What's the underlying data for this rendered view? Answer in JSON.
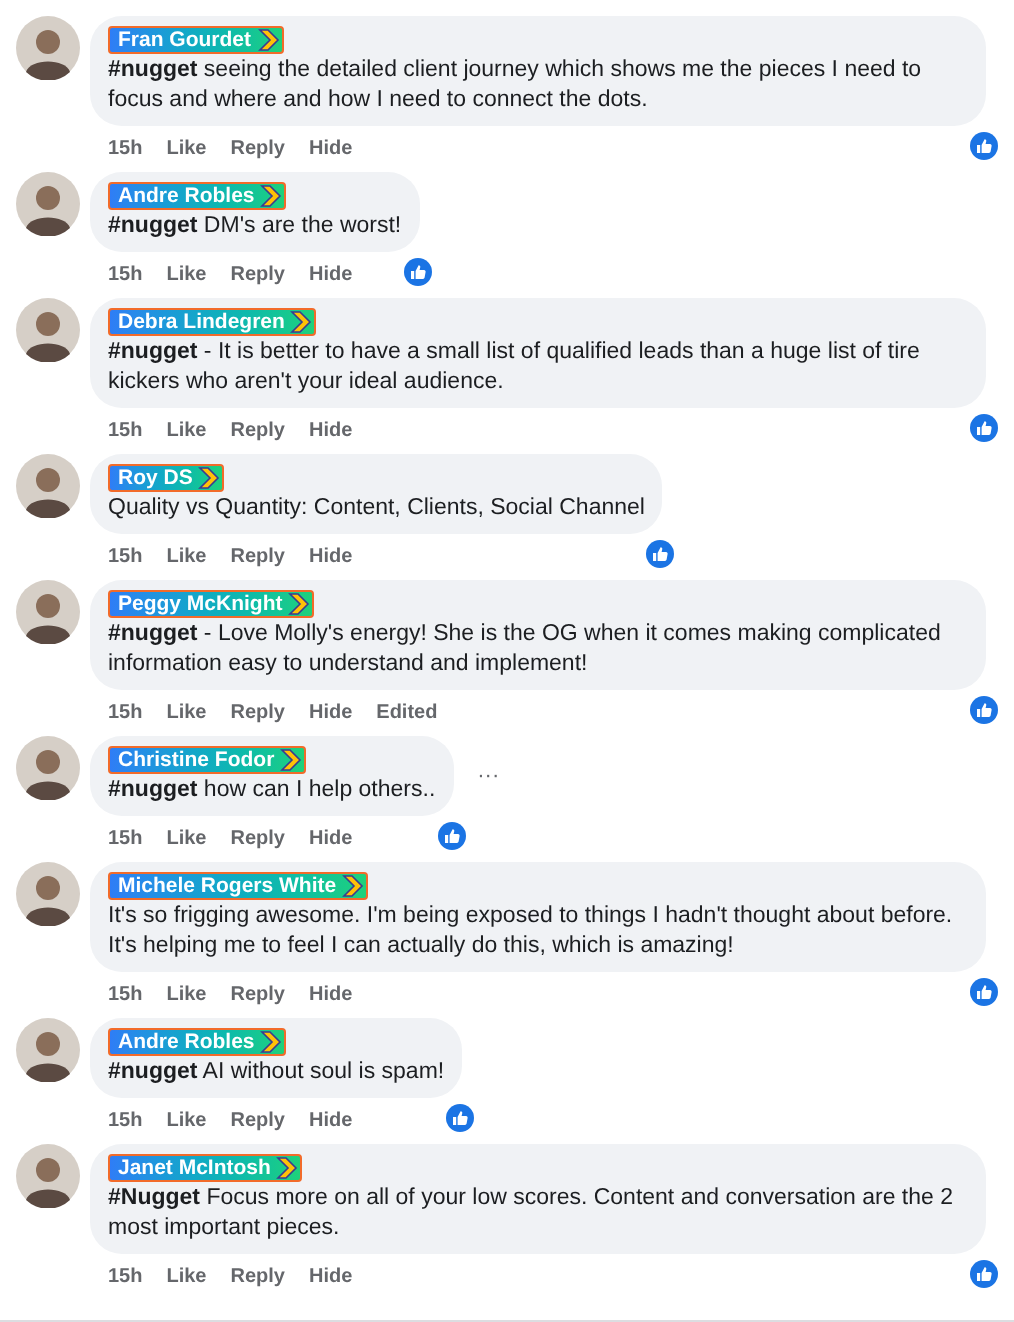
{
  "comments": [
    {
      "author": "Fran Gourdet",
      "text": "**#nugget** seeing the detailed client journey which shows me the pieces I need to focus and where and how I need to connect the dots.",
      "time": "15h",
      "actions": [
        "Like",
        "Reply",
        "Hide"
      ]
    },
    {
      "author": "Andre Robles",
      "text": "**#nugget** DM's are the worst!",
      "time": "15h",
      "actions": [
        "Like",
        "Reply",
        "Hide"
      ]
    },
    {
      "author": "Debra Lindegren",
      "text": "**#nugget** - It is better to have a small list of qualified leads than a huge list of tire kickers who aren't your ideal audience.",
      "time": "15h",
      "actions": [
        "Like",
        "Reply",
        "Hide"
      ]
    },
    {
      "author": "Roy DS",
      "text": "Quality vs Quantity: Content, Clients, Social Channel",
      "time": "15h",
      "actions": [
        "Like",
        "Reply",
        "Hide"
      ]
    },
    {
      "author": "Peggy McKnight",
      "text": "**#nugget** - Love Molly's energy! She is the OG when it comes making complicated information easy to understand and implement!",
      "time": "15h",
      "actions": [
        "Like",
        "Reply",
        "Hide",
        "Edited"
      ]
    },
    {
      "author": "Christine Fodor",
      "text": "**#nugget** how can I help others..",
      "time": "15h",
      "actions": [
        "Like",
        "Reply",
        "Hide"
      ],
      "more": "···"
    },
    {
      "author": "Michele Rogers White",
      "text": "It's so frigging awesome. I'm being exposed to things I hadn't thought about before. It's helping me to feel I can actually do this, which is amazing!",
      "time": "15h",
      "actions": [
        "Like",
        "Reply",
        "Hide"
      ]
    },
    {
      "author": "Andre Robles",
      "text": "**#nugget** AI without soul is spam!",
      "time": "15h",
      "actions": [
        "Like",
        "Reply",
        "Hide"
      ]
    },
    {
      "author": "Janet McIntosh",
      "text": "**#Nugget** Focus more on all of your low scores. Content and conversation are the 2 most important pieces.",
      "time": "15h",
      "actions": [
        "Like",
        "Reply",
        "Hide"
      ]
    }
  ]
}
